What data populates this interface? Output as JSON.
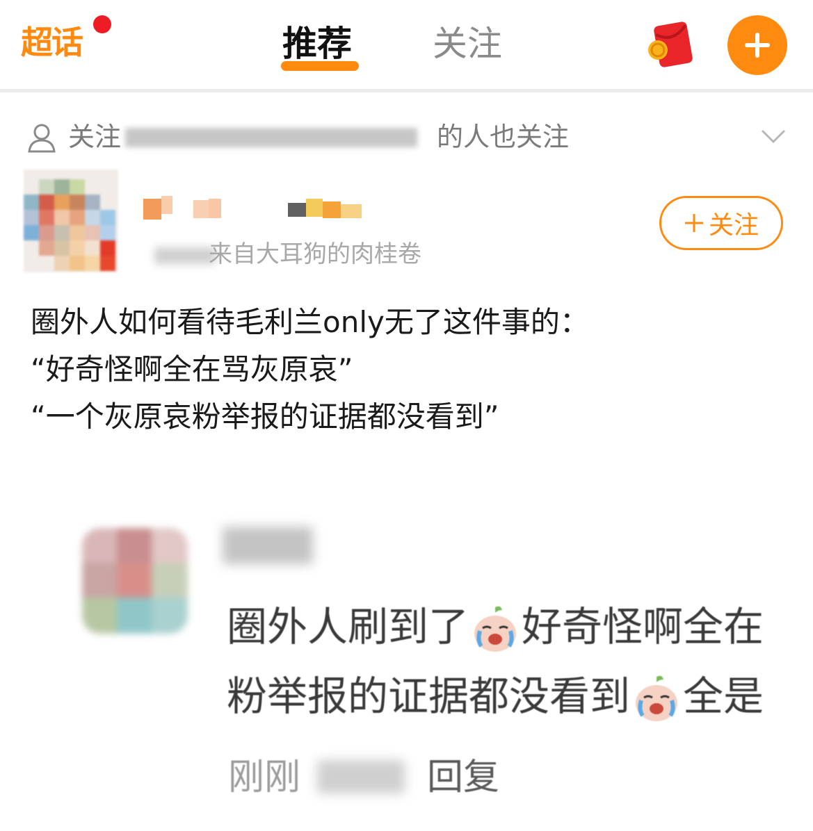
{
  "topbar": {
    "logo_label": "超话",
    "tabs": [
      {
        "label": "推荐",
        "active": true
      },
      {
        "label": "关注",
        "active": false
      }
    ],
    "accent_color": "#ff8a10"
  },
  "follow_hint": {
    "prefix": "关注",
    "suffix": "的人也关注",
    "icons": [
      "person-icon",
      "chevron-down-icon"
    ]
  },
  "post": {
    "source_suffix": "来自大耳狗的肉桂卷",
    "follow_button_label": "关注",
    "body_lines": [
      "圈外人如何看待毛利兰only无了这件事的：",
      "“好奇怪啊全在骂灰原哀”",
      "“一个灰原哀粉举报的证据都没看到”"
    ]
  },
  "embedded_comment": {
    "line1": [
      "圈外人刷到了",
      "好奇怪啊全在"
    ],
    "line2": [
      "粉举报的证据都没看到",
      "全是"
    ],
    "time": "刚刚",
    "reply_label": "回复"
  }
}
